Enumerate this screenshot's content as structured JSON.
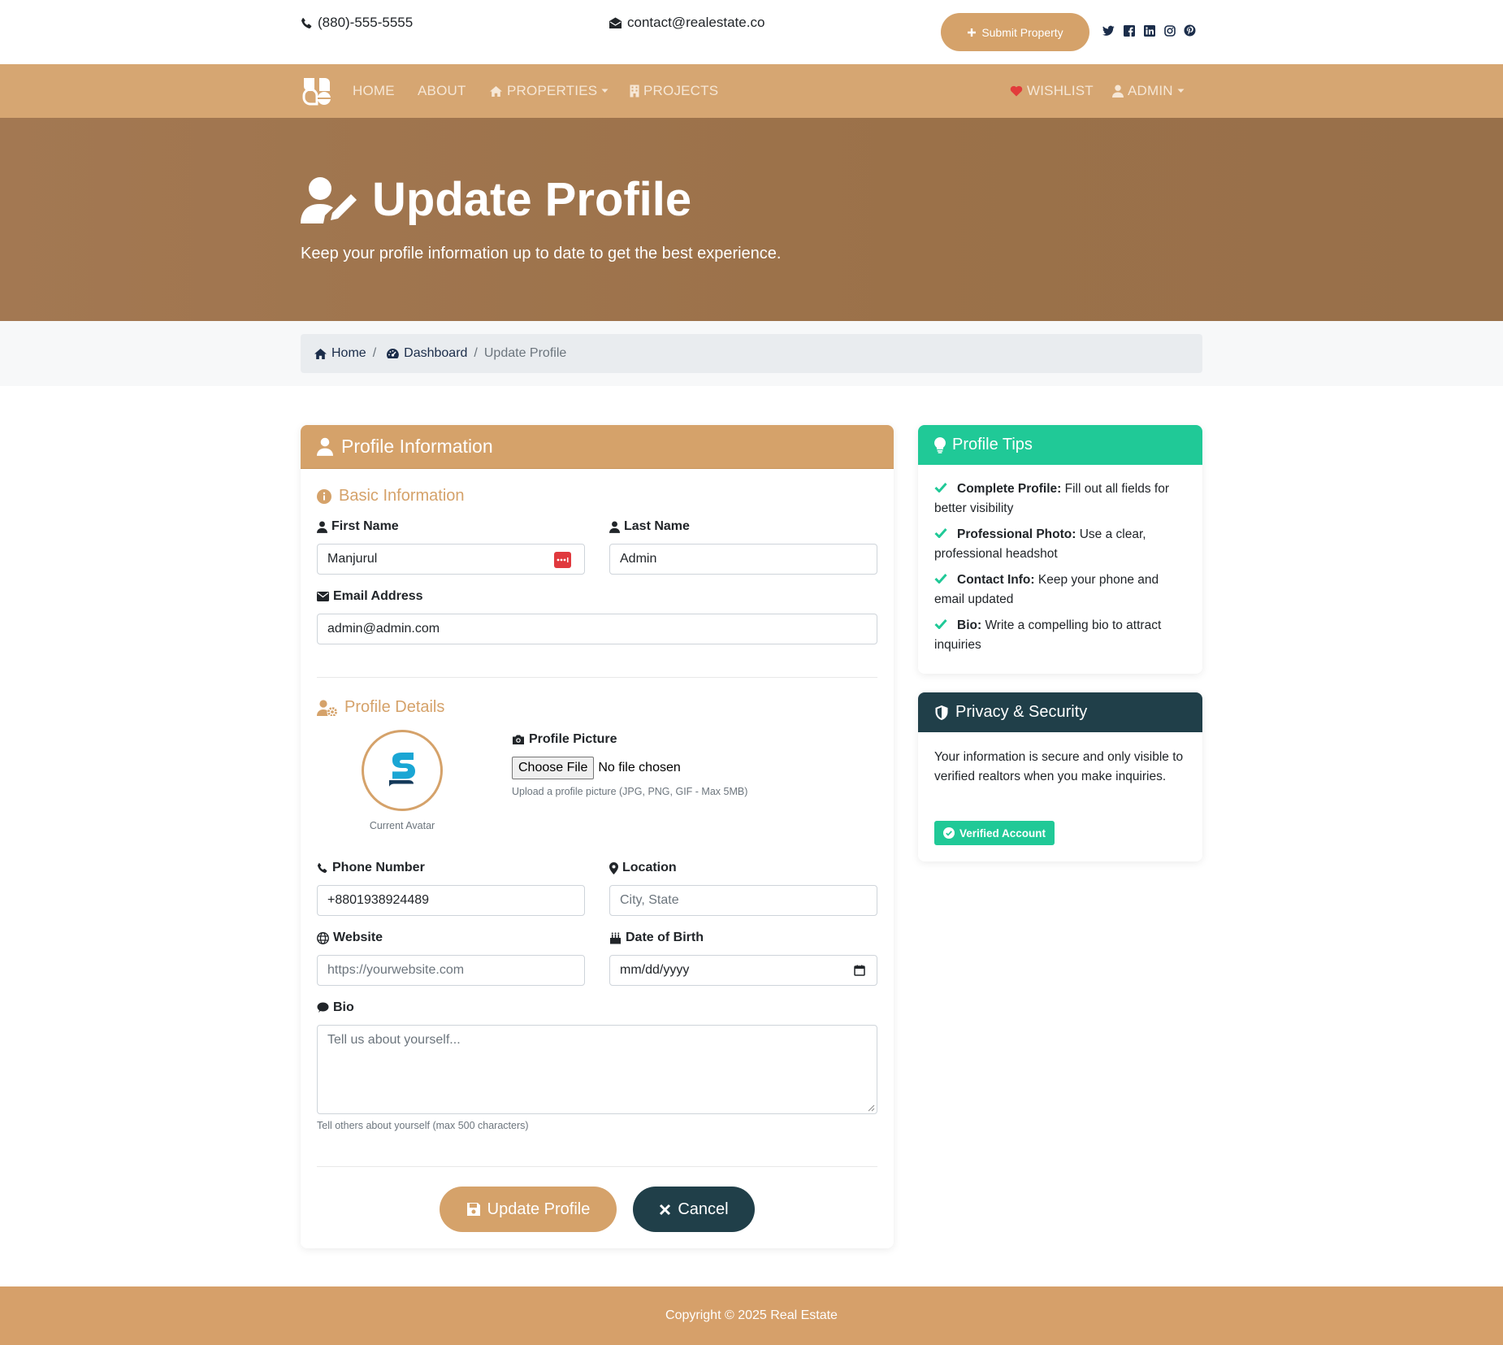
{
  "topbar": {
    "phone": "(880)-555-5555",
    "email": "contact@realestate.co",
    "submit_label": "Submit Property"
  },
  "nav": {
    "home": "HOME",
    "about": "ABOUT",
    "properties": "PROPERTIES",
    "projects": "PROJECTS",
    "wishlist": "WISHLIST",
    "admin": "ADMIN"
  },
  "hero": {
    "title": "Update Profile",
    "subtitle": "Keep your profile information up to date to get the best experience."
  },
  "breadcrumb": {
    "home": "Home",
    "dashboard": "Dashboard",
    "current": "Update Profile",
    "separator": "/"
  },
  "profile_card": {
    "title": "Profile Information",
    "basic_title": "Basic Information",
    "first_name_label": "First Name",
    "first_name_value": "Manjurul",
    "last_name_label": "Last Name",
    "last_name_value": "Admin",
    "email_label": "Email Address",
    "email_value": "admin@admin.com",
    "details_title": "Profile Details",
    "avatar_caption": "Current Avatar",
    "picture_label": "Profile Picture",
    "choose_file": "Choose File",
    "no_file": "No file chosen",
    "picture_help": "Upload a profile picture (JPG, PNG, GIF - Max 5MB)",
    "phone_label": "Phone Number",
    "phone_value": "+8801938924489",
    "location_label": "Location",
    "location_placeholder": "City, State",
    "website_label": "Website",
    "website_placeholder": "https://yourwebsite.com",
    "dob_label": "Date of Birth",
    "dob_placeholder": "mm/dd/yyyy",
    "bio_label": "Bio",
    "bio_placeholder": "Tell us about yourself...",
    "bio_help": "Tell others about yourself (max 500 characters)",
    "update_label": "Update Profile",
    "cancel_label": "Cancel"
  },
  "tips_card": {
    "title": "Profile Tips",
    "tips": [
      {
        "bold": "Complete Profile:",
        "text": " Fill out all fields for better visibility"
      },
      {
        "bold": "Professional Photo:",
        "text": " Use a clear, professional headshot"
      },
      {
        "bold": "Contact Info:",
        "text": " Keep your phone and email updated"
      },
      {
        "bold": "Bio:",
        "text": " Write a compelling bio to attract inquiries"
      }
    ]
  },
  "privacy_card": {
    "title": "Privacy & Security",
    "text": "Your information is secure and only visible to verified realtors when you make inquiries.",
    "badge": "Verified Account"
  },
  "footer": {
    "text": "Copyright © 2025 Real Estate"
  },
  "colors": {
    "brand": "#d5a26a",
    "hero": "#9d734b",
    "tips_header": "#20c997",
    "privacy_header": "#203f49",
    "cancel": "#203f49"
  },
  "icons": [
    "phone-icon",
    "envelope-icon",
    "plus-icon",
    "twitter-icon",
    "facebook-icon",
    "linkedin-icon",
    "instagram-icon",
    "pinterest-icon",
    "logo-icon",
    "home-icon",
    "building-icon",
    "heart-icon",
    "user-icon",
    "user-edit-icon",
    "dashboard-icon",
    "info-icon",
    "user-cog-icon",
    "camera-icon",
    "map-marker-icon",
    "globe-icon",
    "birthday-cake-icon",
    "comment-icon",
    "calendar-icon",
    "save-icon",
    "times-icon",
    "lightbulb-icon",
    "check-icon",
    "shield-icon",
    "check-circle-icon",
    "password-manager-icon"
  ]
}
